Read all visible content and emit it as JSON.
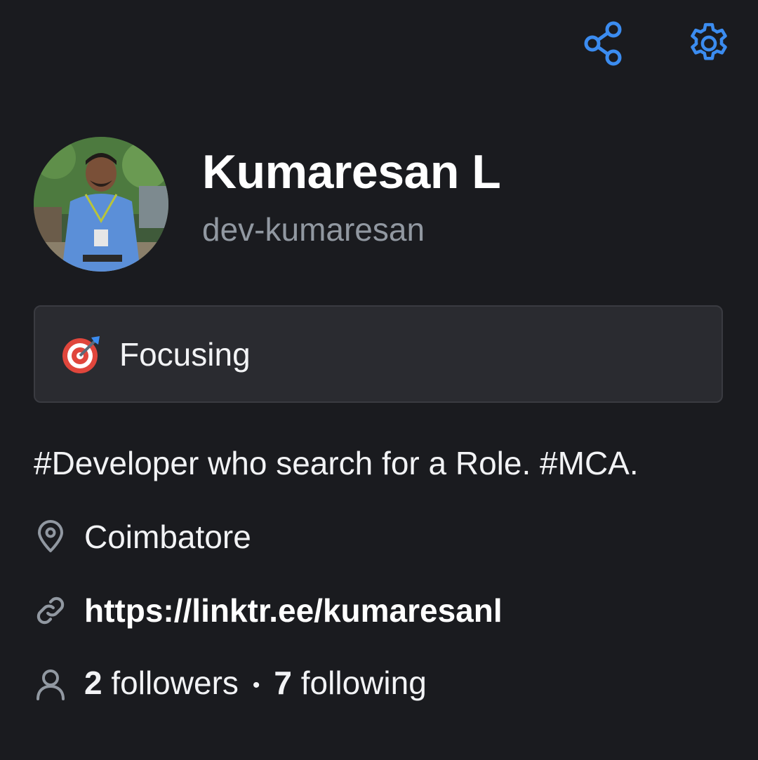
{
  "header": {
    "share_icon": "share-icon",
    "settings_icon": "gear-icon"
  },
  "profile": {
    "display_name": "Kumaresan L",
    "login": "dev-kumaresan"
  },
  "status": {
    "emoji": "direct-hit-target-emoji",
    "text": "Focusing"
  },
  "bio": "#Developer who search for a Role. #MCA.",
  "location": {
    "icon": "location-pin-icon",
    "text": "Coimbatore"
  },
  "website": {
    "icon": "link-icon",
    "text": "https://linktr.ee/kumaresanl"
  },
  "follow": {
    "icon": "person-icon",
    "followers_count": "2",
    "followers_label": "followers",
    "separator": "•",
    "following_count": "7",
    "following_label": "following"
  },
  "colors": {
    "background": "#1a1b1f",
    "accent": "#3b8cf0",
    "muted": "#9198a1",
    "card": "#2a2b30"
  }
}
